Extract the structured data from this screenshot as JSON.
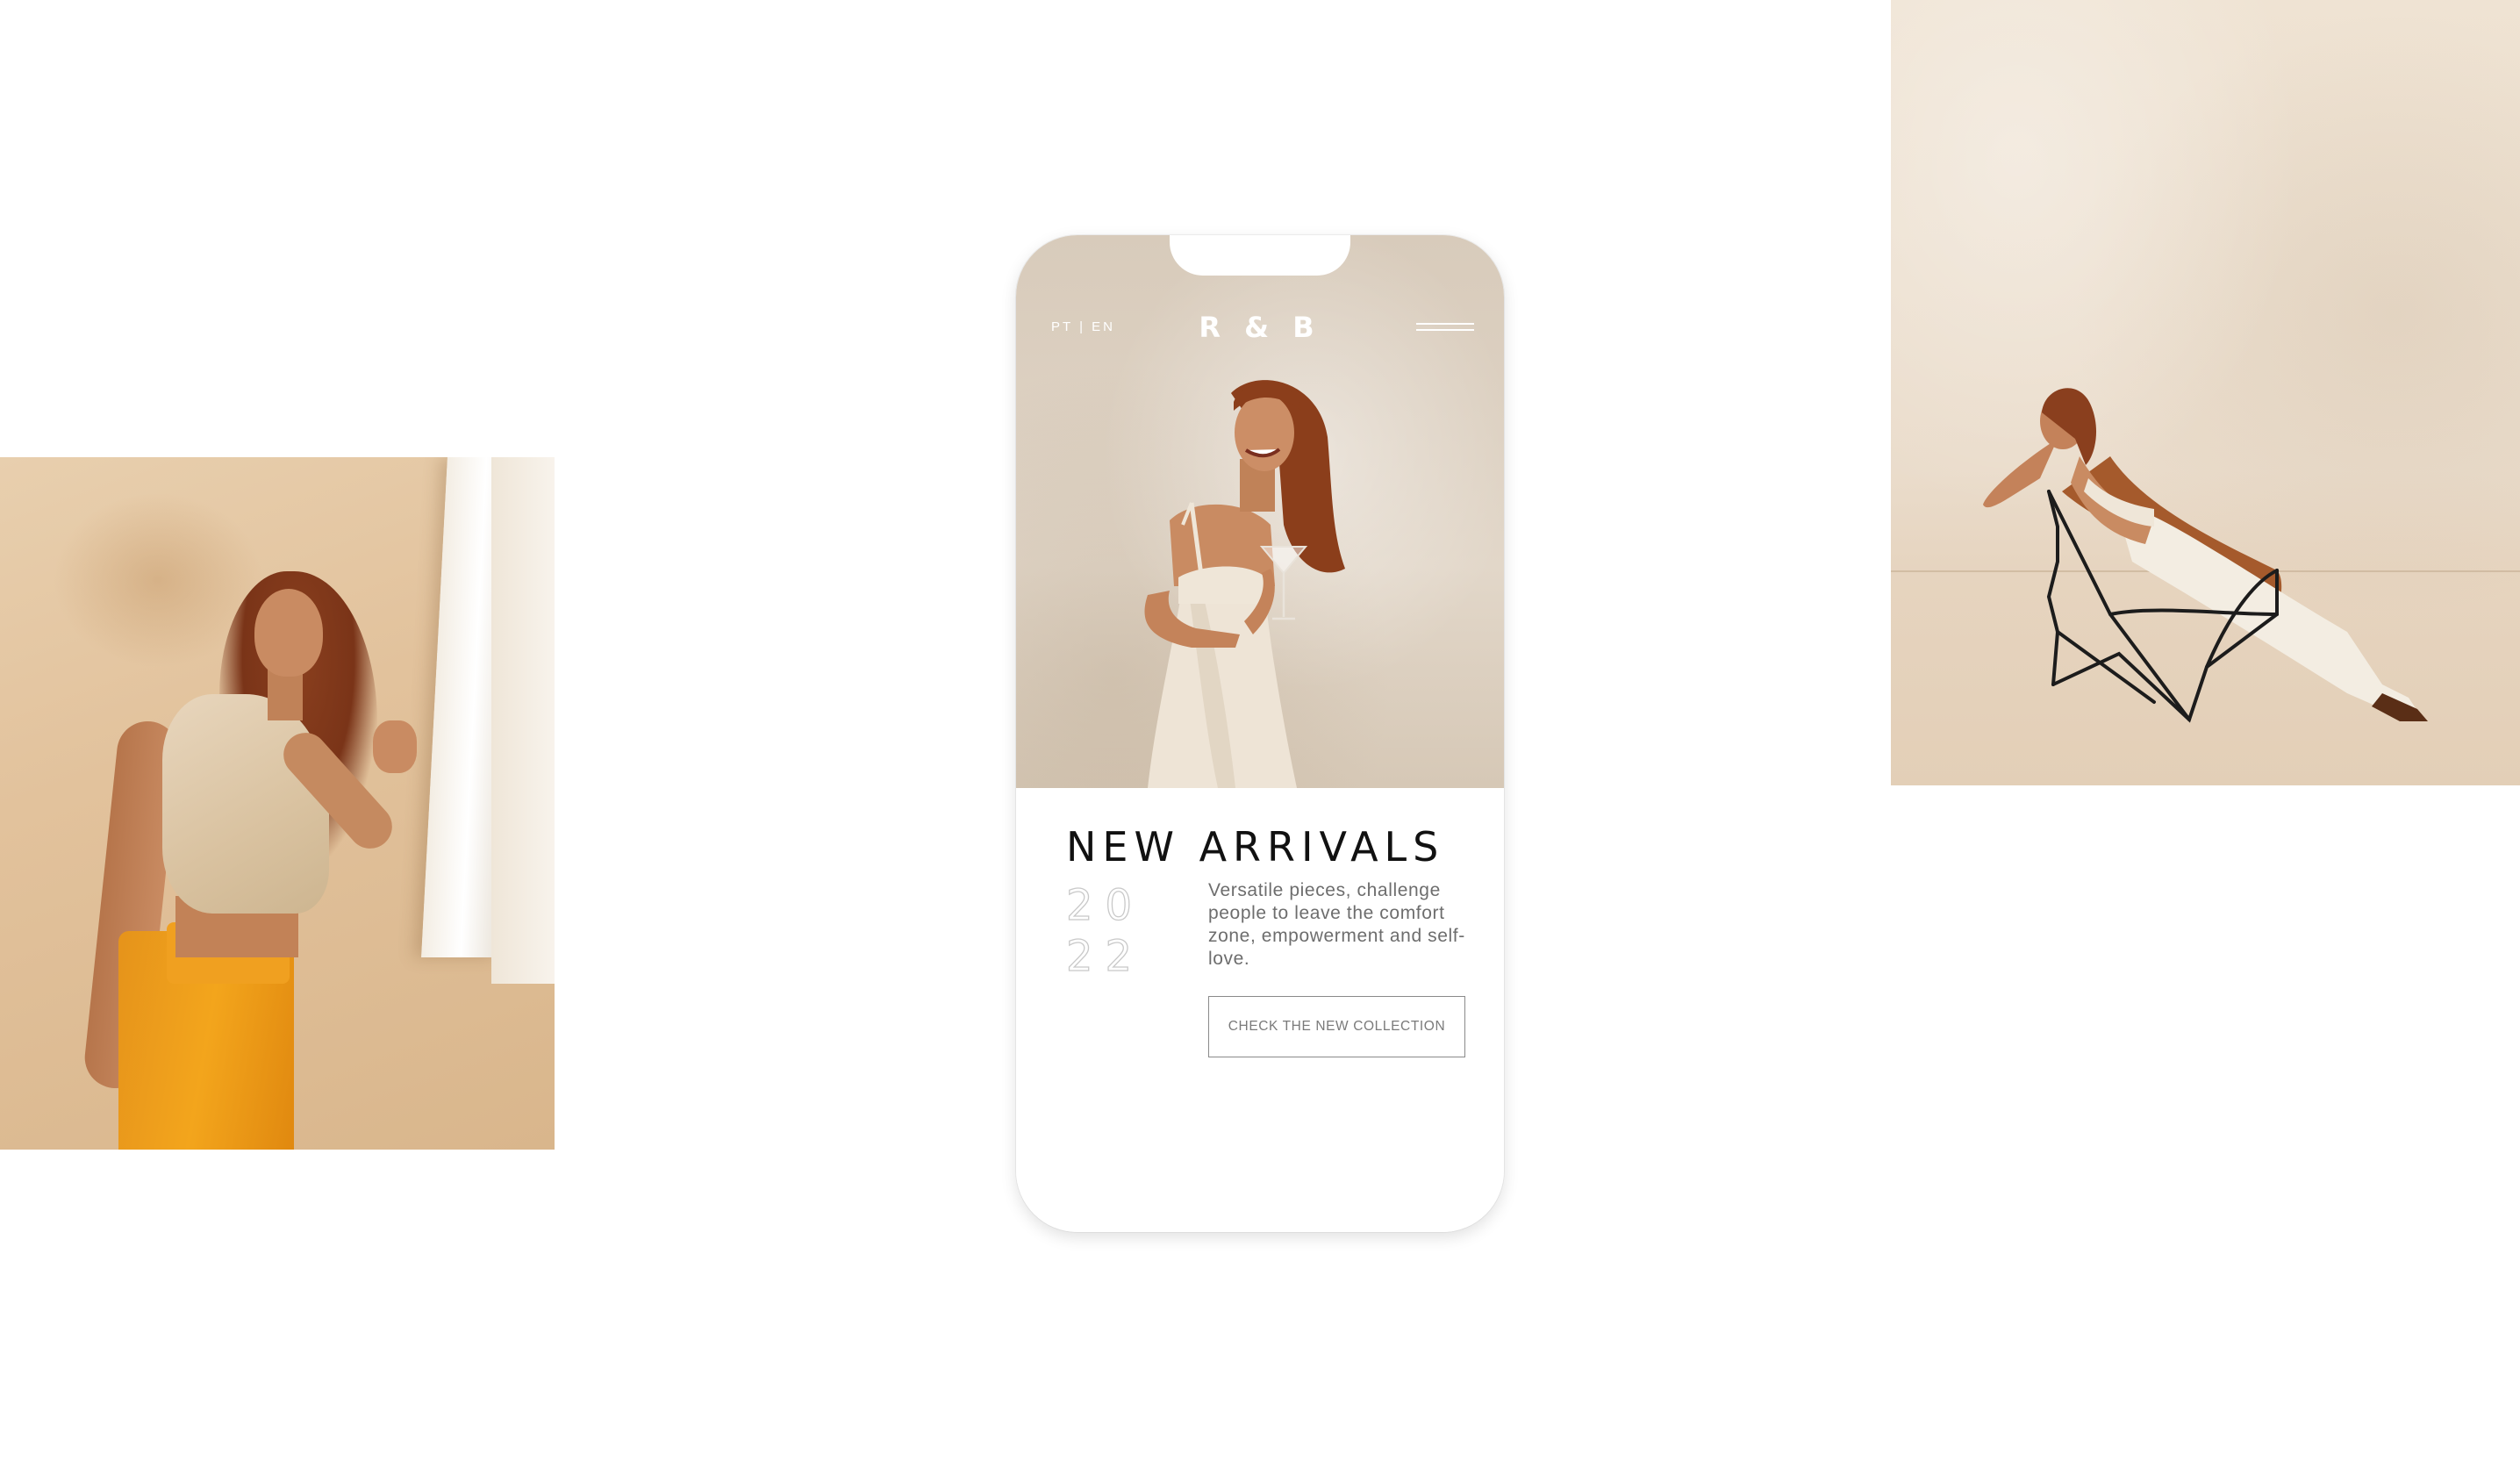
{
  "phone": {
    "lang_switch": "PT | EN",
    "logo": "R & B",
    "menu_icon": "hamburger-menu-icon",
    "headline": "NEW ARRIVALS",
    "year_line_1": "20",
    "year_line_2": "22",
    "description": "Versatile pieces, challenge people to leave the comfort zone, empowerment and self-love.",
    "cta_label": "CHECK THE NEW COLLECTION",
    "scroll_icon": "arrow-down-icon"
  },
  "colors": {
    "background": "#ffffff",
    "headline": "#111111",
    "body_text": "#6d6d6d",
    "hero_bg": "#ddd1c2",
    "pants_orange": "#f3a51c"
  }
}
